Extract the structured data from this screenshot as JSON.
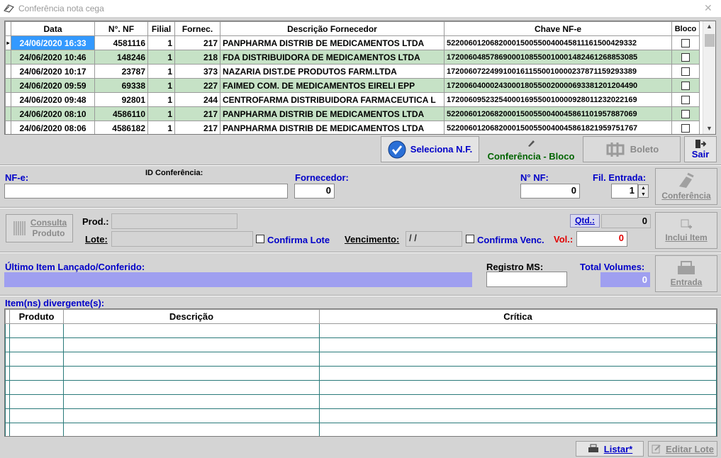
{
  "window": {
    "title": "Conferência nota cega",
    "close_glyph": "✕"
  },
  "grid": {
    "headers": [
      "Data",
      "N°. NF",
      "Filial",
      "Fornec.",
      "Descrição Fornecedor",
      "Chave NF-e",
      "Bloco"
    ],
    "rows": [
      {
        "data": "24/06/2020 16:33",
        "nf": "4581116",
        "filial": "1",
        "fornec": "217",
        "descricao": "PANPHARMA DISTRIB DE MEDICAMENTOS LTDA",
        "chave": "52200601206820001500550040045811161500429332"
      },
      {
        "data": "24/06/2020 10:46",
        "nf": "148246",
        "filial": "1",
        "fornec": "218",
        "descricao": "FDA DISTRIBUIDORA DE MEDICAMENTOS LTDA",
        "chave": "17200604857869000108550010001482461268853085"
      },
      {
        "data": "24/06/2020 10:17",
        "nf": "23787",
        "filial": "1",
        "fornec": "373",
        "descricao": "NAZARIA DIST.DE PRODUTOS FARM.LTDA",
        "chave": "17200607224991001611550010000237871159293389"
      },
      {
        "data": "24/06/2020 09:59",
        "nf": "69338",
        "filial": "1",
        "fornec": "227",
        "descricao": "FAIMED COM. DE MEDICAMENTOS EIRELI EPP",
        "chave": "17200604000243000180550020000693381201204490"
      },
      {
        "data": "24/06/2020 09:48",
        "nf": "92801",
        "filial": "1",
        "fornec": "244",
        "descricao": "CENTROFARMA DISTRIBUIDORA FARMACEUTICA L",
        "chave": "17200609523254000169550010000928011232022169"
      },
      {
        "data": "24/06/2020 08:10",
        "nf": "4586110",
        "filial": "1",
        "fornec": "217",
        "descricao": "PANPHARMA DISTRIB DE MEDICAMENTOS LTDA",
        "chave": "52200601206820001500550040045861101957887069"
      },
      {
        "data": "24/06/2020 08:06",
        "nf": "4586182",
        "filial": "1",
        "fornec": "217",
        "descricao": "PANPHARMA DISTRIB DE MEDICAMENTOS LTDA",
        "chave": "52200601206820001500550040045861821959751767"
      }
    ]
  },
  "buttons": {
    "seleciona": "Seleciona N.F.",
    "conferencia_bloco": "Conferência - Bloco",
    "boleto": "Boleto",
    "sair": "Sair",
    "conferencia": "Conferência",
    "consulta_produto_1": "Consulta",
    "consulta_produto_2": "Produto",
    "inclui_item": "Inclui Item",
    "entrada": "Entrada",
    "listar": "Listar*",
    "editar_lote": "Editar Lote"
  },
  "nf_section": {
    "nfe_label": "NF-e:",
    "id_conferencia_label": "ID Conferência:",
    "fornecedor_label": "Fornecedor:",
    "fornecedor_value": "0",
    "nnf_label": "N° NF:",
    "nnf_value": "0",
    "fil_entrada_label": "Fil. Entrada:",
    "fil_entrada_value": "1"
  },
  "product_section": {
    "prod_label": "Prod.:",
    "lote_label": "Lote:",
    "confirma_lote": "Confirma Lote",
    "vencimento_label": "Vencimento:",
    "vencimento_value": " /  /",
    "confirma_venc": "Confirma Venc.",
    "vol_label": "Vol.:",
    "vol_value": "0",
    "qtd_label": "Qtd.:",
    "qtd_value": "0"
  },
  "last_item": {
    "label": "Último Item Lançado/Conferido:",
    "registro_label": "Registro MS:",
    "total_volumes_label": "Total Volumes:",
    "total_volumes_value": "0"
  },
  "divergent": {
    "label": "Item(ns) divergente(s):",
    "headers": [
      "Produto",
      "Descrição",
      "Crítica"
    ]
  },
  "colors": {
    "selected": "#3399ff",
    "row_green": "#c6e2c6",
    "link_blue": "#0000c8",
    "alert_red": "#e00000",
    "panel": "#d4d4d4"
  }
}
